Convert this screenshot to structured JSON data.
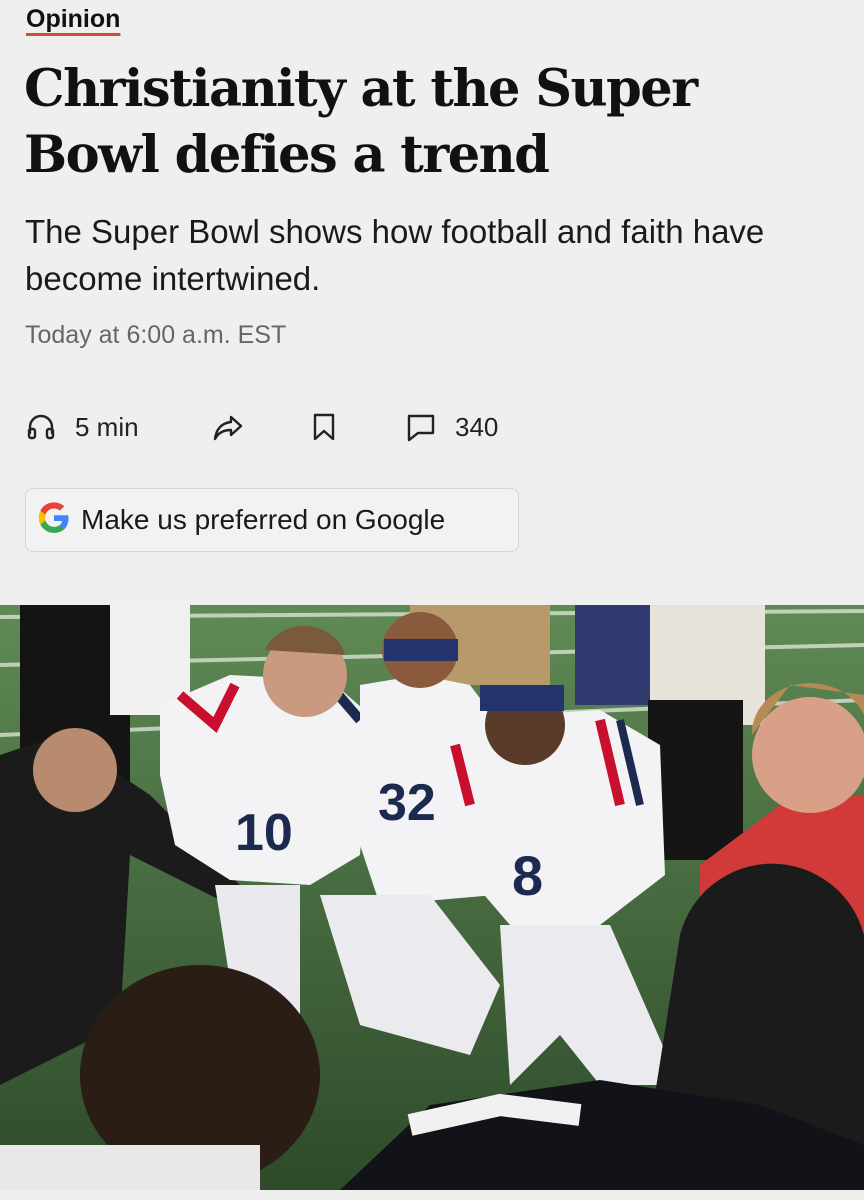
{
  "article": {
    "section": "Opinion",
    "headline": "Christianity at the Super Bowl defies a trend",
    "subhead": "The Super Bowl shows how football and faith have become intertwined.",
    "timestamp": "Today at 6:00 a.m. EST"
  },
  "actions": {
    "listen_label": "5 min",
    "comment_count": "340",
    "icons": [
      "headphones-icon",
      "share-icon",
      "bookmark-icon",
      "comment-icon"
    ]
  },
  "google_button": {
    "label": "Make us preferred on Google",
    "icon": "google-logo-icon"
  },
  "photo": {
    "jersey_numbers": [
      "10",
      "32",
      "8"
    ],
    "colors": {
      "patriots_white": "#f3f3f5",
      "patriots_navy": "#1c2a4f",
      "patriots_red": "#c8102e",
      "turf": "#3f6a37"
    }
  },
  "theme": {
    "accent_underline": "#d4493a",
    "background": "#efefef"
  }
}
